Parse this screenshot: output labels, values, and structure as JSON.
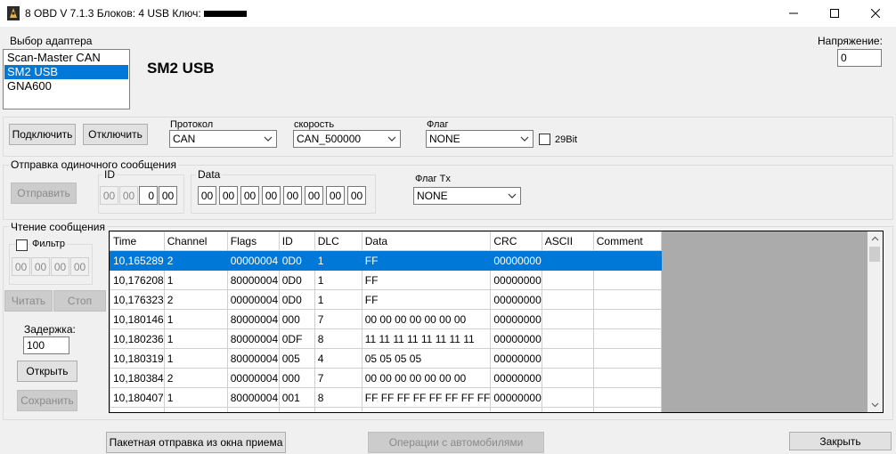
{
  "window": {
    "title": "8 OBD V 7.1.3   Блоков: 4  USB Ключ:",
    "icons": [
      "app-icon",
      "minimize-icon",
      "maximize-icon",
      "close-icon"
    ]
  },
  "adapter": {
    "group_label": "Выбор адаптера",
    "items": [
      "Scan-Master CAN",
      "SM2 USB",
      "GNA600"
    ],
    "selected": "SM2 USB",
    "selected_heading": "SM2 USB"
  },
  "voltage": {
    "label": "Напряжение:",
    "value": "0"
  },
  "connection": {
    "connect_label": "Подключить",
    "disconnect_label": "Отключить",
    "protocol_label": "Протокол",
    "protocol_value": "CAN",
    "speed_label": "скорость",
    "speed_value": "CAN_500000",
    "flag_label": "Флаг",
    "flag_value": "NONE",
    "bit29_label": "29Bit"
  },
  "send": {
    "group_label": "Отправка одиночного сообщения",
    "send_label": "Отправить",
    "id_label": "ID",
    "id_bytes": [
      "00",
      "00",
      "0",
      "00"
    ],
    "data_label": "Data",
    "data_bytes": [
      "00",
      "00",
      "00",
      "00",
      "00",
      "00",
      "00",
      "00"
    ],
    "flag_tx_label": "Флаг Tx",
    "flag_tx_value": "NONE"
  },
  "read": {
    "group_label": "Чтение сообщения",
    "filter_label": "Фильтр",
    "filter_bytes": [
      "00",
      "00",
      "00",
      "00"
    ],
    "read_label": "Читать",
    "stop_label": "Стоп",
    "delay_label": "Задержка:",
    "delay_value": "100",
    "open_label": "Открыть",
    "save_label": "Сохранить"
  },
  "grid": {
    "columns": [
      "Time",
      "Channel",
      "Flags",
      "ID",
      "DLC",
      "Data",
      "CRC",
      "ASCII",
      "Comment"
    ],
    "rows": [
      [
        "10,165289",
        "2",
        "00000004",
        "0D0",
        "1",
        "FF",
        "00000000",
        "",
        ""
      ],
      [
        "10,176208",
        "1",
        "80000004",
        "0D0",
        "1",
        "FF",
        "00000000",
        "",
        ""
      ],
      [
        "10,176323",
        "2",
        "00000004",
        "0D0",
        "1",
        "FF",
        "00000000",
        "",
        ""
      ],
      [
        "10,180146",
        "1",
        "80000004",
        "000",
        "7",
        "00 00 00 00 00 00 00",
        "00000000",
        "",
        ""
      ],
      [
        "10,180236",
        "1",
        "80000004",
        "0DF",
        "8",
        "11 11 11 11 11 11 11 11",
        "00000000",
        "",
        ""
      ],
      [
        "10,180319",
        "1",
        "80000004",
        "005",
        "4",
        "05 05 05 05",
        "00000000",
        "",
        ""
      ],
      [
        "10,180384",
        "2",
        "00000004",
        "000",
        "7",
        "00 00 00 00 00 00 00",
        "00000000",
        "",
        ""
      ],
      [
        "10,180407",
        "1",
        "80000004",
        "001",
        "8",
        "FF FF FF FF FF FF FF FF",
        "00000000",
        "",
        ""
      ],
      [
        "",
        "",
        "",
        "",
        "",
        "",
        "",
        "",
        ""
      ]
    ],
    "selected_row": 0
  },
  "footer": {
    "batch_label": "Пакетная отправка из окна приема",
    "car_ops_label": "Операции с автомобилями",
    "close_label": "Закрыть"
  },
  "colors": {
    "selection": "#0078d7",
    "window_bg": "#f0f0f0",
    "grid_bg": "#ababab"
  }
}
